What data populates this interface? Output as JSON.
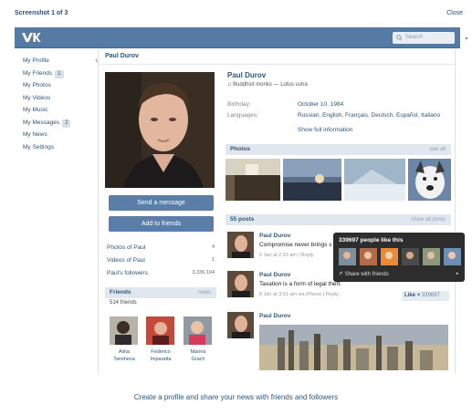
{
  "screenshot_header": {
    "title": "Screenshot 1 of 3",
    "close": "Close"
  },
  "topbar": {
    "logo": "VK",
    "search_placeholder": "Search"
  },
  "nav": {
    "items": [
      {
        "label": "My Profile",
        "extra": "edit"
      },
      {
        "label": "My Friends",
        "badge": "1"
      },
      {
        "label": "My Photos"
      },
      {
        "label": "My Videos"
      },
      {
        "label": "My Music"
      },
      {
        "label": "My Messages",
        "badge": "2"
      },
      {
        "label": "My News"
      },
      {
        "label": "My Settings"
      }
    ]
  },
  "profile": {
    "header_name": "Paul Durov",
    "name": "Paul Durov",
    "song": "Buddhist monks — Lotus sutra",
    "birthday_label": "Birthday:",
    "birthday": "October 10, 1984",
    "languages_label": "Languages:",
    "languages": "Russian, English, Français, Deutsch, Español, Italiano",
    "show_full": "Show full information",
    "send_message": "Send a message",
    "add_friends": "Add to friends",
    "stats": [
      {
        "label": "Photos of Paul",
        "value": "4"
      },
      {
        "label": "Videos of Paul",
        "value": "1"
      },
      {
        "label": "Paul's followers",
        "value": "3,336,104"
      }
    ]
  },
  "friends": {
    "title": "Friends",
    "tab": "news",
    "count": "514 friends",
    "list": [
      {
        "first": "Alina",
        "last": "Tansheva"
      },
      {
        "first": "Federico",
        "last": "Imparatta"
      },
      {
        "first": "Marina",
        "last": "Grach"
      }
    ]
  },
  "photos": {
    "title": "Photos",
    "see_all": "see all"
  },
  "posts": {
    "title": "55 posts",
    "show_all": "show all posts",
    "items": [
      {
        "author": "Paul Durov",
        "text": "Compromise never brings s",
        "meta": "5 Jan at 2:33 am",
        "reply": "Reply"
      },
      {
        "author": "Paul Durov",
        "text": "Taxation is a form of legal theft.",
        "meta": "8 Jan at 3:31 am via iPhone",
        "reply": "Reply"
      },
      {
        "author": "Paul Durov"
      }
    ]
  },
  "like_tooltip": {
    "title": "339697 people like this",
    "share": "Share with friends"
  },
  "like_button": {
    "label": "Like",
    "count": "339697"
  },
  "footer": {
    "caption": "Create a profile and share your news with friends and followers"
  },
  "colors": {
    "topbar": "#557aa3",
    "link": "#2b587a",
    "button": "#5a7ea7",
    "section_bar": "#e1e7ee"
  }
}
